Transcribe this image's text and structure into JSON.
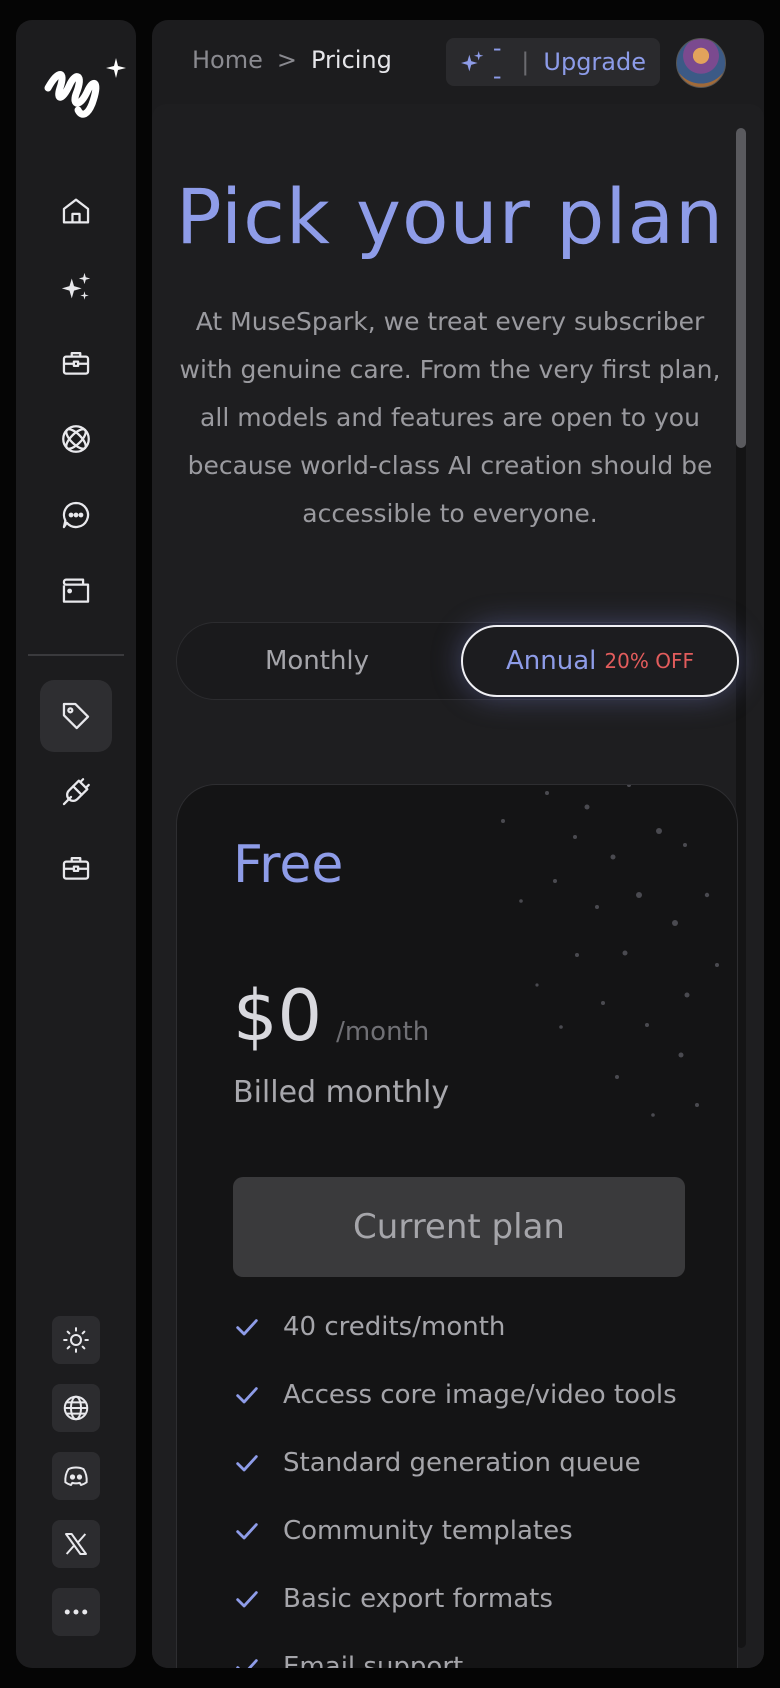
{
  "app": {
    "name": "MuseSpark"
  },
  "sidebar": {
    "nav_items": [
      {
        "name": "home",
        "icon": "home-icon"
      },
      {
        "name": "ai-create",
        "icon": "sparkles-icon"
      },
      {
        "name": "toolbox",
        "icon": "toolbox-icon"
      },
      {
        "name": "models",
        "icon": "atom-icon"
      },
      {
        "name": "chat",
        "icon": "chat-bubble-icon"
      },
      {
        "name": "assets",
        "icon": "wallet-icon"
      },
      {
        "name": "pricing",
        "icon": "price-tag-icon",
        "active": true
      },
      {
        "name": "integrations",
        "icon": "plug-icon"
      },
      {
        "name": "workspace",
        "icon": "briefcase-icon"
      }
    ],
    "utility": [
      {
        "name": "theme",
        "icon": "sun-icon"
      },
      {
        "name": "language",
        "icon": "globe-icon"
      },
      {
        "name": "discord",
        "icon": "discord-icon"
      },
      {
        "name": "x-twitter",
        "icon": "x-logo-icon"
      },
      {
        "name": "more",
        "icon": "more-dots-icon"
      }
    ]
  },
  "header": {
    "breadcrumb": {
      "home": "Home",
      "separator": ">",
      "current": "Pricing"
    },
    "credits": {
      "value": "--",
      "divider": "|",
      "upgrade_label": "Upgrade"
    }
  },
  "pricing": {
    "title": "Pick your plan",
    "subtitle": "At MuseSpark, we treat every subscriber with genuine care. From the very first plan, all models and features are open to you because world-class AI creation should be accessible to everyone.",
    "billing_toggle": {
      "monthly_label": "Monthly",
      "annual_label": "Annual",
      "annual_discount": "20% OFF",
      "selected": "Annual"
    },
    "plans": [
      {
        "name": "Free",
        "price": "$0",
        "price_unit": "/month",
        "billing_note": "Billed monthly",
        "cta_label": "Current plan",
        "features": [
          "40 credits/month",
          "Access core image/video tools",
          "Standard generation queue",
          "Community templates",
          "Basic export formats",
          "Email support"
        ]
      }
    ]
  },
  "colors": {
    "accent": "#8e9ce8",
    "discount": "#e25c5c",
    "background": "#050505",
    "panel": "#1c1c1e"
  }
}
